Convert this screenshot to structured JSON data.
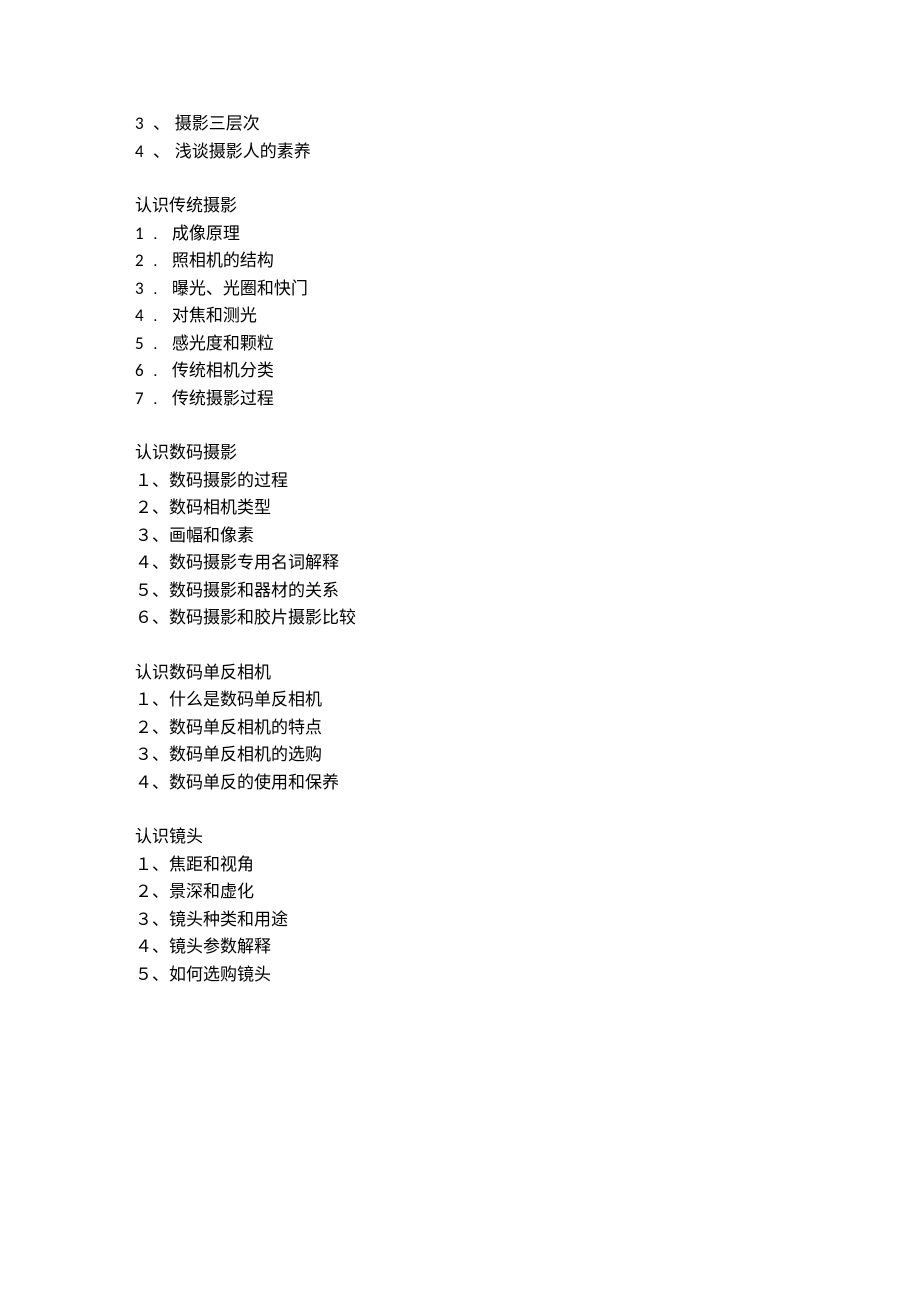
{
  "sections": [
    {
      "heading": null,
      "style": "ascii-cn",
      "items": [
        {
          "num": "3",
          "sep": "、 ",
          "text": "摄影三层次"
        },
        {
          "num": "4",
          "sep": "、 ",
          "text": "浅谈摄影人的素养"
        }
      ]
    },
    {
      "heading": "认识传统摄影",
      "style": "ascii-dot",
      "items": [
        {
          "num": "1",
          "sep": ".   ",
          "text": "成像原理"
        },
        {
          "num": "2",
          "sep": ".   ",
          "text": "照相机的结构"
        },
        {
          "num": "3",
          "sep": ".   ",
          "text": "曝光、光圈和快门"
        },
        {
          "num": "4",
          "sep": ".   ",
          "text": "对焦和测光"
        },
        {
          "num": "5",
          "sep": ".   ",
          "text": "感光度和颗粒"
        },
        {
          "num": "6",
          "sep": ".   ",
          "text": "传统相机分类"
        },
        {
          "num": "7",
          "sep": ".   ",
          "text": "传统摄影过程"
        }
      ]
    },
    {
      "heading": "认识数码摄影",
      "style": "fullwidth",
      "items": [
        {
          "num": "１",
          "sep": "、",
          "text": "数码摄影的过程"
        },
        {
          "num": "２",
          "sep": "、",
          "text": "数码相机类型"
        },
        {
          "num": "３",
          "sep": "、",
          "text": "画幅和像素"
        },
        {
          "num": "４",
          "sep": "、",
          "text": "数码摄影专用名词解释"
        },
        {
          "num": "５",
          "sep": "、",
          "text": "数码摄影和器材的关系"
        },
        {
          "num": "６",
          "sep": "、",
          "text": "数码摄影和胶片摄影比较"
        }
      ]
    },
    {
      "heading": "认识数码单反相机",
      "style": "fullwidth",
      "items": [
        {
          "num": "１",
          "sep": "、",
          "text": "什么是数码单反相机"
        },
        {
          "num": "２",
          "sep": "、",
          "text": "数码单反相机的特点"
        },
        {
          "num": "３",
          "sep": "、",
          "text": "数码单反相机的选购"
        },
        {
          "num": "４",
          "sep": "、",
          "text": "数码单反的使用和保养"
        }
      ]
    },
    {
      "heading": "认识镜头",
      "style": "fullwidth",
      "items": [
        {
          "num": "１",
          "sep": "、",
          "text": "焦距和视角"
        },
        {
          "num": "２",
          "sep": "、",
          "text": "景深和虚化"
        },
        {
          "num": "３",
          "sep": "、",
          "text": "镜头种类和用途"
        },
        {
          "num": "４",
          "sep": "、",
          "text": "镜头参数解释"
        },
        {
          "num": "５",
          "sep": "、",
          "text": "如何选购镜头"
        }
      ]
    }
  ]
}
